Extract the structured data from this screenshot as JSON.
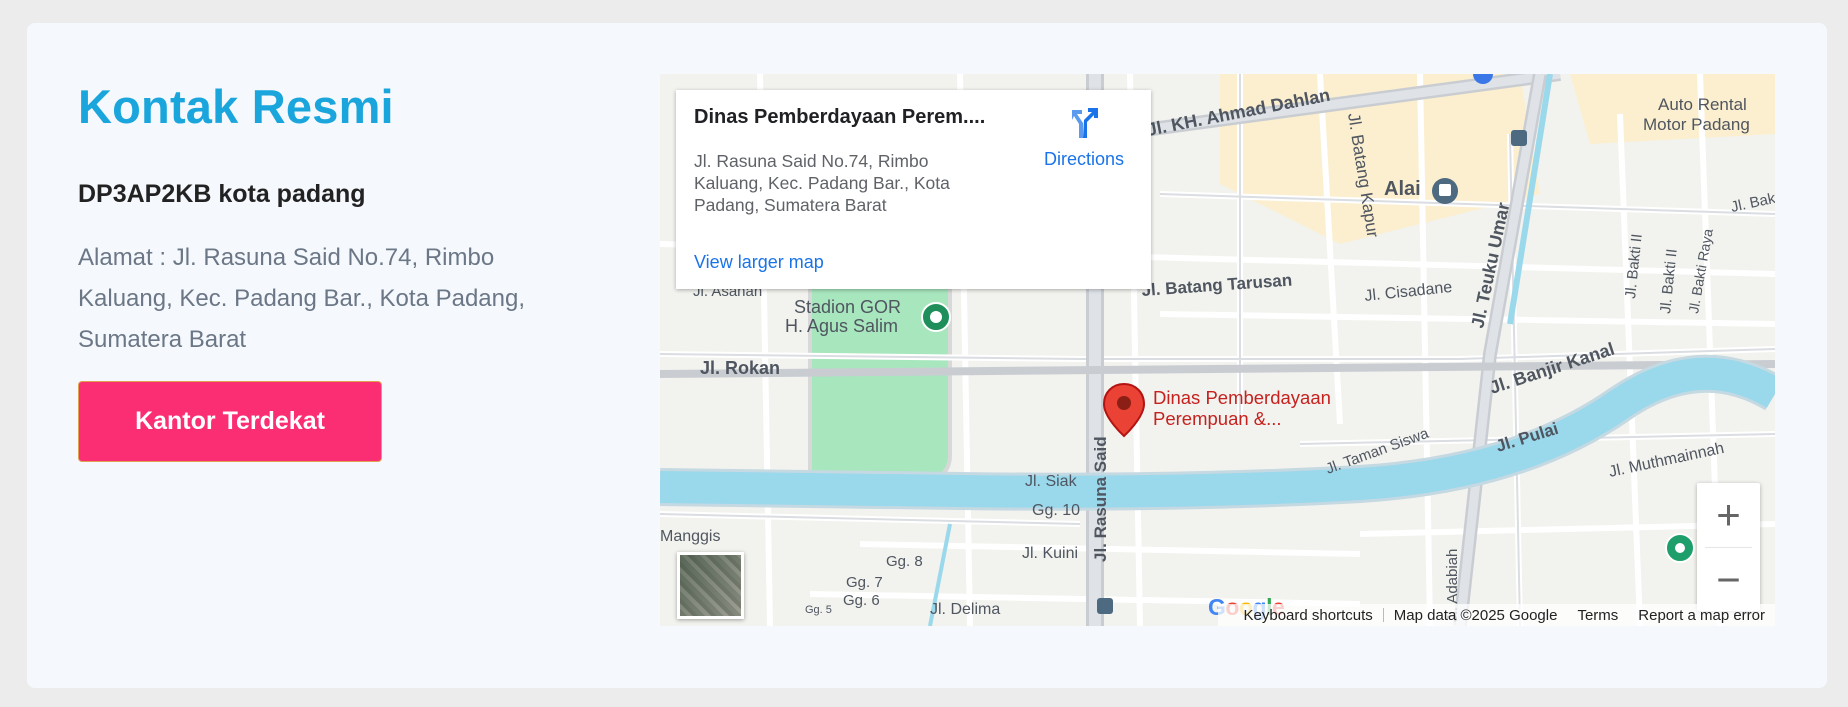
{
  "contact": {
    "heading": "Kontak Resmi",
    "org_name": "DP3AP2KB kota padang",
    "address": "Alamat : Jl. Rasuna Said No.74, Rimbo Kaluang, Kec. Padang Bar., Kota Padang, Sumatera Barat",
    "button_label": "Kantor Terdekat"
  },
  "colors": {
    "heading": "#1aa6dc",
    "button": "#fb2d73",
    "river": "#9ad8ec",
    "park": "#a8e6be",
    "marker": "#ea4335"
  },
  "map": {
    "info": {
      "name": "Dinas Pemberdayaan Perem....",
      "address": "Jl. Rasuna Said No.74, Rimbo Kaluang, Kec. Padang Bar., Kota Padang, Sumatera Barat",
      "directions_label": "Directions",
      "larger_map_label": "View larger map"
    },
    "marker_label_line1": "Dinas Pemberdayaan",
    "marker_label_line2": "Perempuan &...",
    "street_labels": {
      "ahmad_dahlan": "Jl. KH. Ahmad Dahlan",
      "batang_kapur": "Jl. Batang Kapur",
      "alai": "Alai",
      "auto_rental_1": "Auto Rental",
      "auto_rental_2": "Motor Padang",
      "bakti_1": "Jl. Bakti I",
      "bakti_ii": "Jl. Bakti II",
      "bakti_ii_b": "Jl. Bakti II",
      "bakti_raya": "Jl. Bakti Raya",
      "cisadane": "Jl. Cisadane",
      "teuku_umar": "Jl. Teuku Umar",
      "datang_tarusan": "Jl. Batang Tarusan",
      "asahan": "Jl. Asahan",
      "stadion_1": "Stadion GOR",
      "stadion_2": "H. Agus Salim",
      "rokan": "Jl. Rokan",
      "banjir_kanal": "Jl. Banjir Kanal",
      "taman_siswa": "Jl. Taman Siswa",
      "pulai": "Jl. Pulai",
      "muthmainnah": "Jl. Muthmainnah",
      "siak": "Jl. Siak",
      "gg10": "Gg. 10",
      "rasuna_said": "Jl. Rasuna Said",
      "kuini": "Jl. Kuini",
      "manggis": "Manggis",
      "gg8": "Gg. 8",
      "gg7": "Gg. 7",
      "gg6": "Gg. 6",
      "gg5": "Gg. 5",
      "delima": "Jl. Delima",
      "adabiah": "Jl. Adabiah"
    },
    "footer": {
      "keyboard": "Keyboard shortcuts",
      "mapdata": "Map data ©2025 Google",
      "terms": "Terms",
      "report": "Report a map error"
    },
    "icons": {
      "directions": "directions-icon",
      "marker": "map-pin-icon",
      "stadium": "stadium-icon",
      "train": "train-icon",
      "zoom_in": "plus-icon",
      "zoom_out": "minus-icon"
    },
    "zoom_in_glyph": "+",
    "zoom_out_glyph": "−"
  }
}
